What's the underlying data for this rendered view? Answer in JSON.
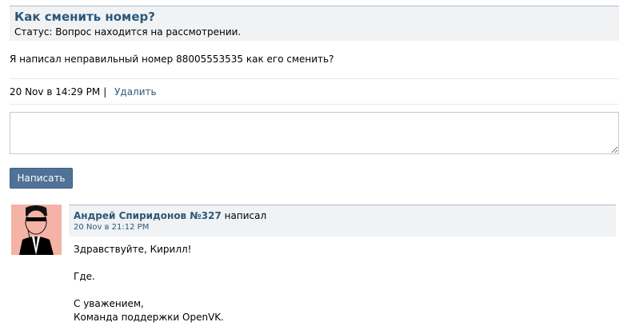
{
  "ticket": {
    "title": "Как сменить номер?",
    "status": "Статус: Вопрос находится на рассмотрении.",
    "question": "Я написал неправильный номер 88005553535 как его сменить?",
    "date": "20 Nov в 14:29 PM",
    "separator": "|",
    "delete_label": "Удалить"
  },
  "reply": {
    "textarea_value": "",
    "submit_label": "Написать"
  },
  "comment": {
    "author": "Андрей Спиридонов №327",
    "action": "написал",
    "date": "20 Nov в 21:12 PM",
    "avatar_icon": "man-in-suit-sunglasses-icon",
    "body_lines": [
      "Здравствуйте, Кирилл!",
      "Где.",
      "С уважением,",
      "Команда поддержки OpenVK."
    ]
  },
  "colors": {
    "link": "#2b587a",
    "button": "#4f7296",
    "header_bg": "#f0f2f4",
    "avatar_bg": "#f4b3a4"
  }
}
